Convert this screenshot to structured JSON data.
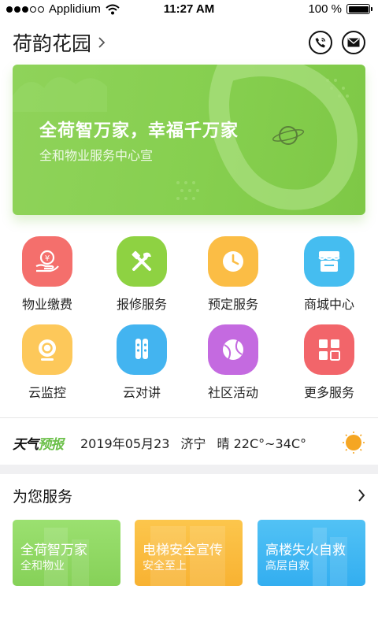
{
  "status_bar": {
    "carrier": "Applidium",
    "time": "11:27 AM",
    "battery": "100 %",
    "signal_bars_filled": 3,
    "signal_bars_total": 5
  },
  "header": {
    "community_name": "荷韵花园",
    "icons": [
      "chevron-right-icon",
      "phone-icon",
      "mail-icon"
    ]
  },
  "banner": {
    "title": "全荷智万家，幸福千万家",
    "subtitle": "全和物业服务中心宣",
    "color": "#86cf4f"
  },
  "services": [
    {
      "label": "物业缴费",
      "icon": "payment-icon",
      "color": "#f46f6c"
    },
    {
      "label": "报修服务",
      "icon": "repair-tools-icon",
      "color": "#8ed242"
    },
    {
      "label": "预定服务",
      "icon": "clock-icon",
      "color": "#fbbd45"
    },
    {
      "label": "商城中心",
      "icon": "store-icon",
      "color": "#45bdf0"
    },
    {
      "label": "云监控",
      "icon": "camera-icon",
      "color": "#fdc85a"
    },
    {
      "label": "云对讲",
      "icon": "intercom-icon",
      "color": "#43b4f0"
    },
    {
      "label": "社区活动",
      "icon": "ball-icon",
      "color": "#c46ae0"
    },
    {
      "label": "更多服务",
      "icon": "grid-icon",
      "color": "#f2656a"
    }
  ],
  "weather": {
    "logo_part1": "天气",
    "logo_part2": "预报",
    "date": "2019年05月23",
    "city": "济宁",
    "condition": "晴",
    "temperature": "22C°~34C°"
  },
  "for_you": {
    "title": "为您服务",
    "cards": [
      {
        "title": "全荷智万家",
        "subtitle": "全和物业",
        "color": "#8fd760"
      },
      {
        "title": "电梯安全宣传",
        "subtitle": "安全至上",
        "color": "#fbbd3d"
      },
      {
        "title": "高楼失火自救",
        "subtitle": "高层自救",
        "color": "#3fb7f2"
      }
    ]
  }
}
